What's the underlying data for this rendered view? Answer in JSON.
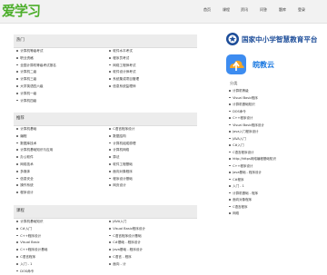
{
  "logo": "爱学习",
  "nav": [
    "首页",
    "课程",
    "资讯",
    "问答",
    "题库",
    "登录"
  ],
  "sections": [
    {
      "title": "热门",
      "left": [
        "计算机等级考试",
        "职业资格",
        "全国计算机等级考试报名",
        "计算机二级",
        "计算机三级",
        "大学英语四六级",
        "计算机一级",
        "计算机四级"
      ],
      "right": [
        "软件水平考试",
        "程序员考试",
        "网络工程师考试",
        "软件设计师考试",
        "系统集成项目管理",
        "信息系统监理师"
      ]
    },
    {
      "title": "推荐",
      "left": [
        "计算机基础",
        "编程",
        "数据库技术",
        "计算机基础知识与应用",
        "办公软件",
        "网络技术",
        "多媒体",
        "信息安全",
        "操作系统",
        "程序设计"
      ],
      "right": [
        "C语言程序设计",
        "数据结构",
        "计算机组成原理",
        "计算机网络",
        "算法",
        "软件工程基础",
        "面向对象程序",
        "程序设计基础",
        "网页设计"
      ]
    },
    {
      "title": "课程",
      "left": [
        "计算机基础知识",
        "C#入门",
        "C++程序设计",
        "Visual Basic",
        "C++程序设计基础",
        "C语言程序",
        "入门 - 1",
        "DOS命令"
      ],
      "right": [
        "JAVA入门",
        "Visual Basic程序设计",
        "C语言程序设计基础",
        "C#基础 - 程序设计",
        "Java基础 - 程序设计",
        "C语言 - 程序",
        "面向 - 计"
      ]
    }
  ],
  "sidebar": {
    "banner1": "国家中小学智慧教育平台",
    "banner2": "皖教云",
    "list_title": "分类",
    "items": [
      "计算机等级",
      "Visual Basic程序",
      "计算机基础知识",
      "DOS命令",
      "C++程序设计",
      "Visual Basic程序设计",
      "Java入门程序设计",
      "JAVA入门",
      "C#入门",
      "C语言程序设计",
      "http://https网络编程基础知识",
      "C++程序设计",
      "Java基础 - 程序设计",
      "C#程序",
      "入门 - 1",
      "计算机基础 - 程序",
      "面向对象程序",
      "C语言程序",
      "网络"
    ]
  },
  "colors": {
    "logo": "#4cae2a",
    "banner1": "#1d4d99",
    "banner2": "#1a78e0",
    "head_bg": "#ececec"
  }
}
